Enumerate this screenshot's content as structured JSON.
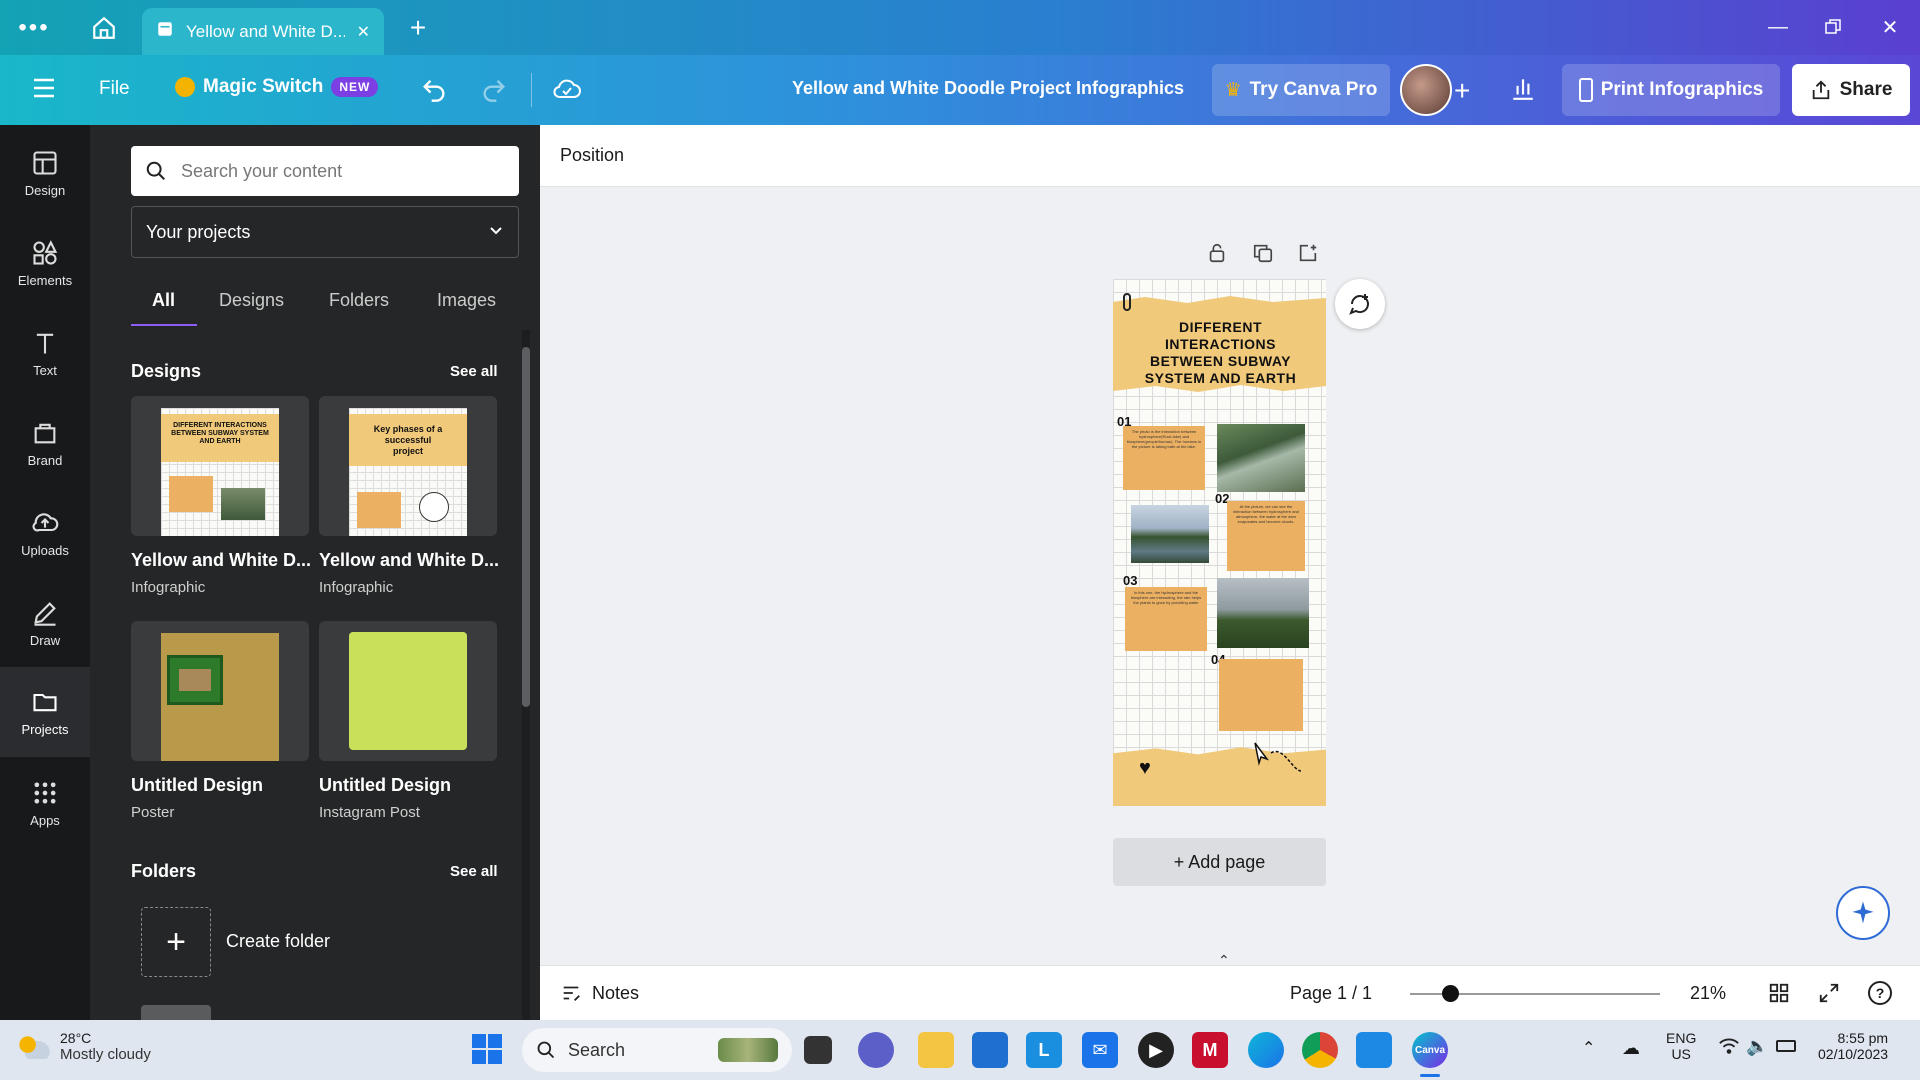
{
  "browser": {
    "tab_title": "Yellow and White D...",
    "more_icon": "more-dots-icon",
    "home_icon": "home-icon",
    "new_tab": "+"
  },
  "toolbar": {
    "menu_icon": "hamburger-icon",
    "file_label": "File",
    "magic_switch_label": "Magic Switch",
    "new_badge": "NEW",
    "design_title": "Yellow and White Doodle Project Infographics",
    "try_pro_label": "Try Canva Pro",
    "print_label": "Print Infographics",
    "share_label": "Share"
  },
  "rail": {
    "items": [
      {
        "label": "Design",
        "icon": "design-icon"
      },
      {
        "label": "Elements",
        "icon": "elements-icon"
      },
      {
        "label": "Text",
        "icon": "text-icon"
      },
      {
        "label": "Brand",
        "icon": "brand-icon"
      },
      {
        "label": "Uploads",
        "icon": "uploads-icon"
      },
      {
        "label": "Draw",
        "icon": "draw-icon"
      },
      {
        "label": "Projects",
        "icon": "folder-icon"
      },
      {
        "label": "Apps",
        "icon": "apps-icon"
      }
    ],
    "active": "Projects"
  },
  "panel": {
    "search_placeholder": "Search your content",
    "projects_select": "Your projects",
    "tabs": [
      "All",
      "Designs",
      "Folders",
      "Images"
    ],
    "active_tab": "All",
    "designs_title": "Designs",
    "see_all": "See all",
    "designs": [
      {
        "name": "Yellow and White D...",
        "type": "Infographic",
        "thumb_text": "DIFFERENT INTERACTIONS BETWEEN SUBWAY SYSTEM AND EARTH"
      },
      {
        "name": "Yellow and White D...",
        "type": "Infographic",
        "thumb_text": "Key phases of a successful project"
      },
      {
        "name": "Untitled Design",
        "type": "Poster"
      },
      {
        "name": "Untitled Design",
        "type": "Instagram Post"
      }
    ],
    "folders_title": "Folders",
    "create_folder_label": "Create folder"
  },
  "context_bar": {
    "position_label": "Position"
  },
  "canvas": {
    "page_title": "DIFFERENT INTERACTIONS BETWEEN SUBWAY SYSTEM AND EARTH",
    "steps": [
      "01",
      "02",
      "03",
      "04"
    ],
    "step1_text": "The photo is the interaction between hydrosphere(Rock lake) and biosphere(people/human). The humans in the picture is taking bath at the lake.",
    "step2_text": "At the picture, we can see the interaction between hydrosphere and atmosphere, the water at the dam evaporates and become clouds.",
    "step3_text": "In this one, the hydrosphere and the biosphere are interacting, the rain helps the plants to grow by providing water",
    "add_page_label": "+ Add page"
  },
  "bottom_bar": {
    "notes_label": "Notes",
    "page_indicator": "Page 1 / 1",
    "zoom_level": "21%",
    "zoom_fraction": 0.16
  },
  "taskbar": {
    "temperature": "28°C",
    "weather": "Mostly cloudy",
    "search_label": "Search",
    "lang_top": "ENG",
    "lang_bottom": "US",
    "time": "8:55 pm",
    "date": "02/10/2023"
  },
  "colors": {
    "panel_bg": "#252627",
    "rail_bg": "#18191b",
    "accent_purple": "#8b5cf6",
    "poster_paper": "#f0c97a",
    "instagram_green": "#c8e05a"
  }
}
